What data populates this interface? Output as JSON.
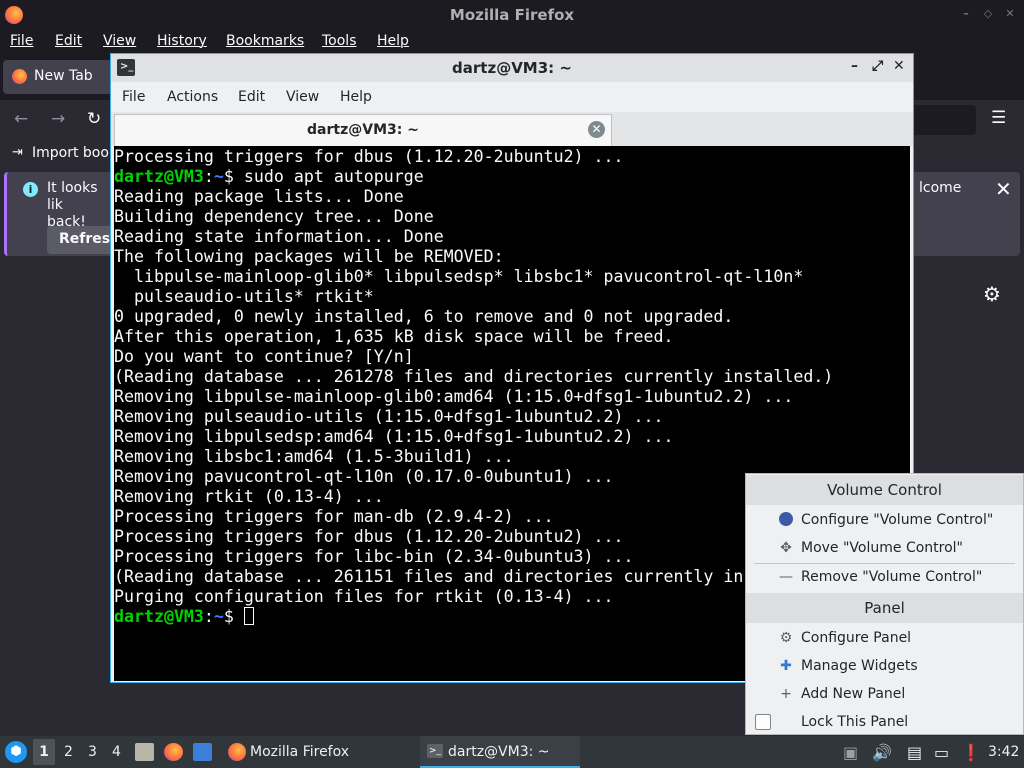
{
  "firefox": {
    "window_title": "Mozilla Firefox",
    "menu": [
      "File",
      "Edit",
      "View",
      "History",
      "Bookmarks",
      "Tools",
      "Help"
    ],
    "tab_label": "New Tab",
    "bookmarks_item": "Import bookm",
    "notification": {
      "message_line1": "It looks lik",
      "message_line2": "back!",
      "welcome_fragment": "lcome",
      "refresh_button": "Refresh"
    }
  },
  "terminal": {
    "window_title": "dartz@VM3: ~",
    "menu": [
      "File",
      "Actions",
      "Edit",
      "View",
      "Help"
    ],
    "tab_label": "dartz@VM3: ~",
    "prompt_user": "dartz@VM3",
    "prompt_path": "~",
    "lines": [
      {
        "text": "Processing triggers for dbus (1.12.20-2ubuntu2) ..."
      },
      {
        "prompt": true,
        "text": " sudo apt autopurge"
      },
      {
        "text": "Reading package lists... Done"
      },
      {
        "text": "Building dependency tree... Done"
      },
      {
        "text": "Reading state information... Done"
      },
      {
        "text": "The following packages will be REMOVED:"
      },
      {
        "text": "  libpulse-mainloop-glib0* libpulsedsp* libsbc1* pavucontrol-qt-l10n*"
      },
      {
        "text": "  pulseaudio-utils* rtkit*"
      },
      {
        "text": "0 upgraded, 0 newly installed, 6 to remove and 0 not upgraded."
      },
      {
        "text": "After this operation, 1,635 kB disk space will be freed."
      },
      {
        "text": "Do you want to continue? [Y/n]"
      },
      {
        "text": "(Reading database ... 261278 files and directories currently installed.)"
      },
      {
        "text": "Removing libpulse-mainloop-glib0:amd64 (1:15.0+dfsg1-1ubuntu2.2) ..."
      },
      {
        "text": "Removing pulseaudio-utils (1:15.0+dfsg1-1ubuntu2.2) ..."
      },
      {
        "text": "Removing libpulsedsp:amd64 (1:15.0+dfsg1-1ubuntu2.2) ..."
      },
      {
        "text": "Removing libsbc1:amd64 (1.5-3build1) ..."
      },
      {
        "text": "Removing pavucontrol-qt-l10n (0.17.0-0ubuntu1) ..."
      },
      {
        "text": "Removing rtkit (0.13-4) ..."
      },
      {
        "text": "Processing triggers for man-db (2.9.4-2) ..."
      },
      {
        "text": "Processing triggers for dbus (1.12.20-2ubuntu2) ..."
      },
      {
        "text": "Processing triggers for libc-bin (2.34-0ubuntu3) ..."
      },
      {
        "text": "(Reading database ... 261151 files and directories currently in"
      },
      {
        "text": "Purging configuration files for rtkit (0.13-4) ..."
      },
      {
        "prompt": true,
        "text": " ",
        "cursor": true
      }
    ]
  },
  "context_menu": {
    "section1_title": "Volume Control",
    "configure_item": "Configure \"Volume Control\"",
    "move_item": "Move \"Volume Control\"",
    "remove_item": "Remove \"Volume Control\"",
    "section2_title": "Panel",
    "configure_panel": "Configure Panel",
    "manage_widgets": "Manage Widgets",
    "add_new_panel": "Add New Panel",
    "lock_panel": "Lock This Panel"
  },
  "taskbar": {
    "workspaces": [
      "1",
      "2",
      "3",
      "4"
    ],
    "firefox_task": "Mozilla Firefox",
    "terminal_task": "dartz@VM3: ~",
    "clock": "3:42"
  },
  "colors": {
    "prompt_user": "#00d400",
    "prompt_path": "#3c78ff",
    "active_border": "#3daee9",
    "firefox_accent": "#ab71ff"
  }
}
